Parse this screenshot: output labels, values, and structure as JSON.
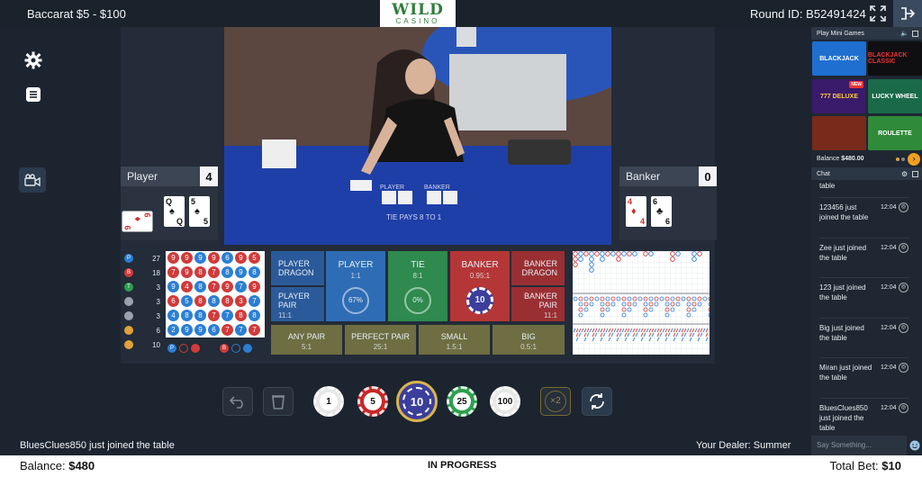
{
  "topbar": {
    "game_title": "Baccarat  $5 - $100",
    "logo_line1": "WILD",
    "logo_line2": "CASINO",
    "round_label": "Round ID:",
    "round_id": "B52491424"
  },
  "player": {
    "label": "Player",
    "score": "4",
    "cards": [
      {
        "rank": "6",
        "suit": "♦",
        "color": "red"
      },
      {
        "rank": "Q",
        "suit": "♠",
        "color": "black"
      },
      {
        "rank": "5",
        "suit": "♠",
        "color": "black"
      }
    ]
  },
  "banker": {
    "label": "Banker",
    "score": "0",
    "cards": [
      {
        "rank": "4",
        "suit": "♦",
        "color": "red"
      },
      {
        "rank": "6",
        "suit": "♣",
        "color": "black"
      }
    ]
  },
  "stats": [
    {
      "letter": "P",
      "color": "#2a7fd4",
      "count": "27"
    },
    {
      "letter": "B",
      "color": "#d13a3a",
      "count": "18"
    },
    {
      "letter": "T",
      "color": "#2e9e4f",
      "count": "3"
    },
    {
      "letter": "",
      "color": "#9aa3ad",
      "count": "3"
    },
    {
      "letter": "",
      "color": "#9aa3ad",
      "count": "3"
    },
    {
      "letter": "",
      "color": "#e0a23a",
      "count": "6"
    },
    {
      "letter": "",
      "color": "#e0a23a",
      "count": "10"
    }
  ],
  "bead_rows": [
    [
      "9",
      "9",
      "9",
      "9",
      "6",
      "9",
      "5"
    ],
    [
      "7",
      "9",
      "8",
      "7",
      "8",
      "9",
      "8"
    ],
    [
      "9",
      "4",
      "8",
      "7",
      "9",
      "7",
      "9"
    ],
    [
      "6",
      "5",
      "8",
      "8",
      "8",
      "3",
      "7"
    ],
    [
      "4",
      "8",
      "8",
      "7",
      "7",
      "8",
      "8"
    ],
    [
      "2",
      "9",
      "9",
      "6",
      "7",
      "7",
      "7"
    ]
  ],
  "bead_colors": [
    [
      "r",
      "r",
      "b",
      "r",
      "b",
      "r",
      "r"
    ],
    [
      "r",
      "r",
      "r",
      "r",
      "b",
      "b",
      "b"
    ],
    [
      "b",
      "r",
      "b",
      "r",
      "r",
      "b",
      "r"
    ],
    [
      "r",
      "b",
      "r",
      "b",
      "r",
      "r",
      "b"
    ],
    [
      "b",
      "b",
      "b",
      "r",
      "b",
      "r",
      "b"
    ],
    [
      "b",
      "b",
      "b",
      "b",
      "r",
      "b",
      "r"
    ]
  ],
  "bead_predict": {
    "p_label": "P",
    "b_label": "B"
  },
  "bets": {
    "player_dragon": {
      "name": "PLAYER\nDRAGON"
    },
    "player_pair": {
      "name": "PLAYER\nPAIR",
      "odds": "11:1"
    },
    "player": {
      "name": "PLAYER",
      "odds": "1:1",
      "pct": "67%"
    },
    "tie": {
      "name": "TIE",
      "odds": "8:1",
      "pct": "0%"
    },
    "banker": {
      "name": "BANKER",
      "odds": "0.95:1",
      "chip": "10"
    },
    "banker_dragon": {
      "name": "BANKER\nDRAGON"
    },
    "banker_pair": {
      "name": "BANKER\nPAIR",
      "odds": "11:1"
    },
    "any_pair": {
      "name": "ANY PAIR",
      "odds": "5:1"
    },
    "perfect_pair": {
      "name": "PERFECT PAIR",
      "odds": "25:1"
    },
    "small": {
      "name": "SMALL",
      "odds": "1.5:1"
    },
    "big": {
      "name": "BIG",
      "odds": "0.5:1"
    }
  },
  "video": {
    "player_label": "PLAYER",
    "banker_label": "BANKER",
    "tie_label": "TIE PAYS 8 TO 1"
  },
  "chips": [
    {
      "value": "1",
      "color": "#e8e8e8",
      "text": "#222"
    },
    {
      "value": "5",
      "color": "#c62828",
      "text": "#fff"
    },
    {
      "value": "10",
      "color": "#3c3e9c",
      "text": "#fff",
      "selected": true
    },
    {
      "value": "25",
      "color": "#2e9e4f",
      "text": "#fff"
    },
    {
      "value": "100",
      "color": "#e8e8e8",
      "text": "#222"
    }
  ],
  "double_label": "×2",
  "status_message": "BluesClues850 just joined the table",
  "dealer": "Your Dealer: Summer",
  "bottom": {
    "balance_label": "Balance:",
    "balance": "$480",
    "status": "IN PROGRESS",
    "total_label": "Total Bet:",
    "total": "$10"
  },
  "right_panel": {
    "mini_title": "Play Mini Games",
    "games": [
      "BLACKJACK",
      "BLACKJACK CLASSIC",
      "777 DELUXE",
      "LUCKY WHEEL",
      "",
      "ROULETTE"
    ],
    "new_badge": "NEW",
    "balance_label": "Balance",
    "balance": "$480.00",
    "chat_title": "Chat",
    "chat_top": "table",
    "chat_messages": [
      {
        "text": "123456 just joined the table",
        "time": "12:04"
      },
      {
        "text": "Zee just joined the table",
        "time": "12:04"
      },
      {
        "text": "123 just joined the table",
        "time": "12:04"
      },
      {
        "text": "Big just joined the table",
        "time": "12:04"
      },
      {
        "text": "Miran just joined the table",
        "time": "12:04"
      },
      {
        "text": "BluesClues850 just joined the table",
        "time": "12:04"
      }
    ],
    "chat_placeholder": "Say Something..."
  },
  "colors": {
    "player_blue": "#2e6db5",
    "banker_red": "#b53636",
    "tie_green": "#2e8a4e",
    "side_blue": "#2a5a9a",
    "side_red": "#9a2f33",
    "olive": "#6e6e42"
  }
}
